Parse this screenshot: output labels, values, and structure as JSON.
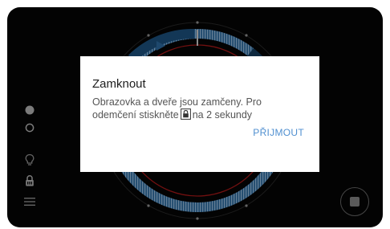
{
  "dialog": {
    "title": "Zamknout",
    "body_part1": "Obrazovka a dveře jsou zamčeny. Pro odemčení stiskněte",
    "body_part2": "na 2 sekundy",
    "inline_icon": "lock-icon",
    "action_label": "PŘIJMOUT"
  },
  "sidebar": {
    "items": [
      {
        "icon": "filled-dot-icon"
      },
      {
        "icon": "outline-dot-icon"
      },
      {
        "icon": "lightbulb-icon"
      },
      {
        "icon": "lock-icon"
      },
      {
        "icon": "menu-icon"
      }
    ]
  },
  "controls": {
    "stop_icon": "stop-icon",
    "dial_play_icon": "play-icon"
  },
  "colors": {
    "dial_blue": "#3f7fb6",
    "dial_dark_blue": "#1e5585",
    "ring_red": "#b01a1a",
    "accent_link": "#4f8fd0",
    "background": "#050505"
  }
}
